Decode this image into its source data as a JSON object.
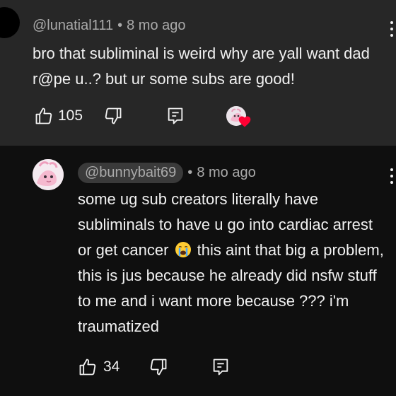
{
  "comments": [
    {
      "author": "@lunatial111",
      "time": "8 mo ago",
      "separator": "•",
      "text": "bro that subliminal is weird why are yall want dad r@pe u..? but ur some subs are good!",
      "likes": "105",
      "creator_hearted": true,
      "icons": {
        "like": "thumbs-up-icon",
        "dislike": "thumbs-down-icon",
        "reply": "reply-icon",
        "more": "kebab-menu-icon",
        "heart": "creator-heart-icon"
      }
    },
    {
      "author": "@bunnybait69",
      "time": "8 mo ago",
      "separator": "•",
      "text_part1": "some ug sub creators literally have subliminals to have u go into cardiac arrest or get cancer",
      "emoji": "loudly-crying-face",
      "text_part2": "this aint that big a problem, this is jus because he already did nsfw stuff to me and i want more because ??? i'm traumatized",
      "likes": "34",
      "icons": {
        "like": "thumbs-up-icon",
        "dislike": "thumbs-down-icon",
        "reply": "reply-icon",
        "more": "kebab-menu-icon"
      }
    }
  ],
  "colors": {
    "highlight_bg": "#272727",
    "page_bg": "#0f0f0f",
    "text_primary": "#f1f1f1",
    "text_secondary": "#aaaaaa",
    "heart_red": "#ff0033"
  }
}
